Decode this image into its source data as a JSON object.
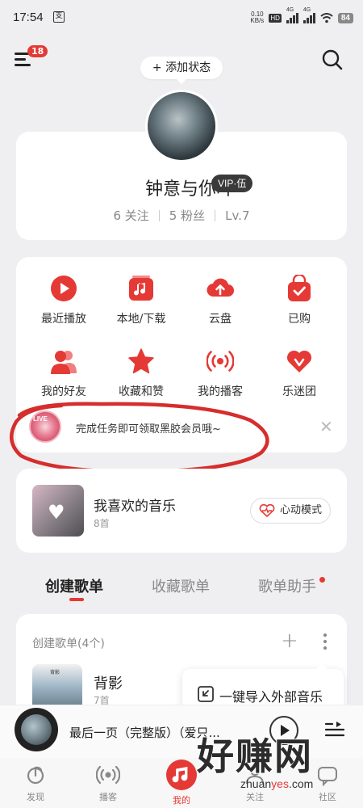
{
  "status_bar": {
    "time": "17:54",
    "small_icon": "支",
    "net_speed": "0.10",
    "net_unit": "KB/s",
    "hd": "HD",
    "signal_label": "4G",
    "battery": "84"
  },
  "topbar": {
    "notification_count": "18",
    "add_status_label": "+ 添加状态"
  },
  "profile": {
    "username": "钟意与你吖",
    "vip_badge": "VIP·伍",
    "following": "6 关注",
    "followers": "5 粉丝",
    "level": "Lv.7"
  },
  "shortcuts": [
    {
      "label": "最近播放",
      "icon": "play-icon"
    },
    {
      "label": "本地/下载",
      "icon": "music-note-icon"
    },
    {
      "label": "云盘",
      "icon": "cloud-upload-icon"
    },
    {
      "label": "已购",
      "icon": "bag-check-icon"
    },
    {
      "label": "我的好友",
      "icon": "friends-icon"
    },
    {
      "label": "收藏和赞",
      "icon": "star-icon"
    },
    {
      "label": "我的播客",
      "icon": "broadcast-icon"
    },
    {
      "label": "乐迷团",
      "icon": "heart-badge-icon"
    }
  ],
  "promo": {
    "text": "完成任务即可领取黑胶会员哦~",
    "badge": "LIVE"
  },
  "liked": {
    "title": "我喜欢的音乐",
    "count": "8首",
    "heartbeat_label": "心动模式"
  },
  "tabs": [
    "创建歌单",
    "收藏歌单",
    "歌单助手"
  ],
  "playlists": {
    "header": "创建歌单(4个)",
    "items": [
      {
        "title": "背影",
        "count": "7首"
      }
    ]
  },
  "import_popup": {
    "label": "一键导入外部音乐"
  },
  "mini_player": {
    "title": "最后一页（完整版）（爱只..."
  },
  "bottom_nav": [
    {
      "label": "发现",
      "icon": "discover-icon"
    },
    {
      "label": "播客",
      "icon": "podcast-icon"
    },
    {
      "label": "我的",
      "icon": "music-icon",
      "active": true
    },
    {
      "label": "关注",
      "icon": "follow-icon"
    },
    {
      "label": "社区",
      "icon": "community-icon"
    }
  ],
  "watermark": {
    "big": "好赚网",
    "small_pre": "zhuan",
    "small_mid": "yes",
    "small_post": ".com"
  },
  "colors": {
    "accent": "#e53935",
    "background": "#efeff1",
    "card": "#ffffff"
  }
}
